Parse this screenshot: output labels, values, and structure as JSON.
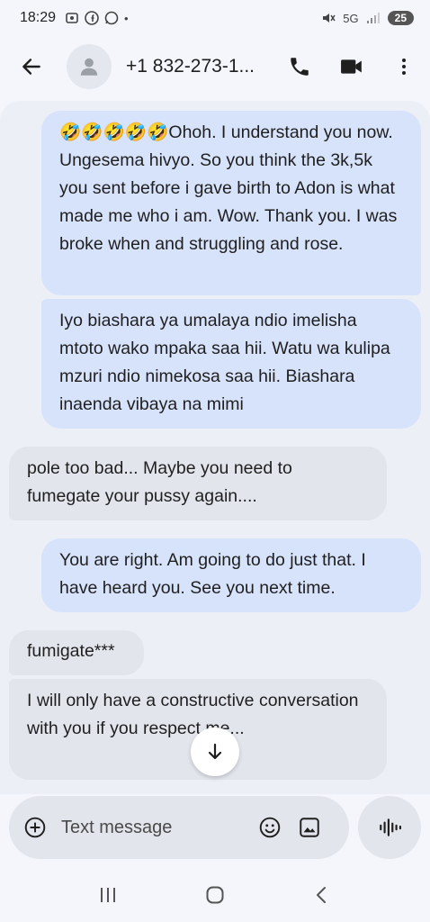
{
  "status_bar": {
    "time": "18:29",
    "network": "5G",
    "battery": "25"
  },
  "header": {
    "contact": "+1 832-273-1...",
    "icons": {
      "back": "arrow-left-icon",
      "avatar": "person-icon",
      "call": "phone-icon",
      "video": "video-camera-icon",
      "menu": "more-vertical-icon"
    }
  },
  "messages": [
    {
      "direction": "outgoing",
      "text": "🤣🤣🤣🤣🤣Ohoh. I understand you now. Ungesema hivyo. So you think the 3k,5k you sent before i gave birth to Adon is what made me who i am. Wow. Thank you. I was broke when and struggling and rose."
    },
    {
      "direction": "outgoing",
      "text": "Iyo biashara ya umalaya ndio imelisha mtoto wako mpaka saa hii. Watu wa kulipa mzuri ndio nimekosa saa hii. Biashara inaenda vibaya na mimi"
    },
    {
      "direction": "incoming",
      "text": "pole too bad... Maybe you need to fumegate  your pussy again...."
    },
    {
      "direction": "outgoing",
      "text": "You are right. Am going to do just that. I have heard you. See you next time."
    },
    {
      "direction": "incoming",
      "text": "fumigate***"
    },
    {
      "direction": "incoming",
      "text": "I will only have a constructive conversation with you if you respect me..."
    }
  ],
  "compose": {
    "placeholder": "Text message",
    "icons": {
      "add": "plus-circle-icon",
      "emoji": "emoji-icon",
      "image": "image-icon",
      "voice": "voice-waveform-icon"
    }
  },
  "colors": {
    "outgoing_bubble": "#d7e2fb",
    "incoming_bubble": "#e2e5ec",
    "background": "#f4f6fb"
  }
}
